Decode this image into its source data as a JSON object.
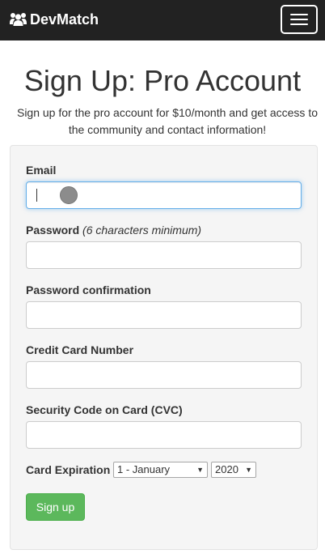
{
  "navbar": {
    "brand": "DevMatch",
    "brand_icon": "users-icon",
    "toggle_icon": "hamburger-icon",
    "background": "#222222"
  },
  "page": {
    "title": "Sign Up: Pro Account",
    "subtitle_line1": "Sign up for the pro account for $10/month and get access to",
    "subtitle_line2": "the community and contact information!"
  },
  "form": {
    "email_label": "Email",
    "email_value": "",
    "password_label": "Password",
    "password_hint": "(6 characters minimum)",
    "password_value": "",
    "password_confirmation_label": "Password confirmation",
    "password_confirmation_value": "",
    "card_number_label": "Credit Card Number",
    "card_number_value": "",
    "cvc_label": "Security Code on Card (CVC)",
    "cvc_value": "",
    "expiration_label": "Card Expiration",
    "expiration_month": "1 - January",
    "expiration_year": "2020",
    "submit_label": "Sign up",
    "submit_color": "#5cb85c"
  }
}
